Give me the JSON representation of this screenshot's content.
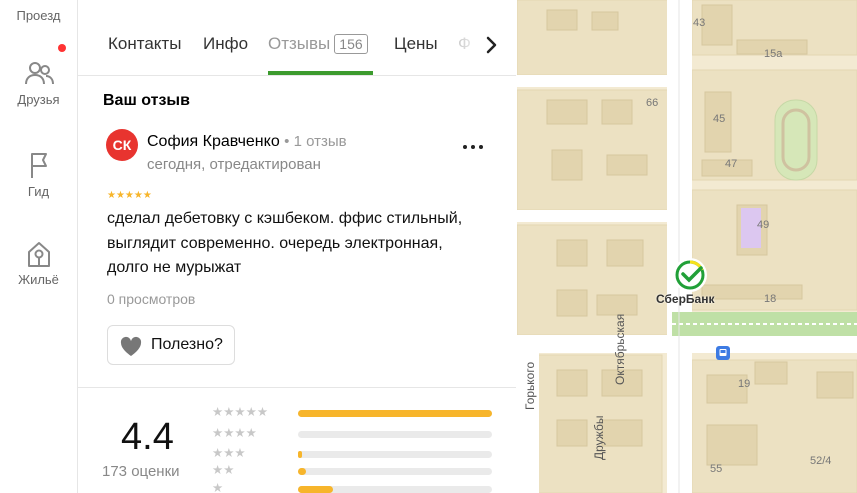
{
  "sidebar": {
    "items": [
      {
        "label": "Проезд",
        "icon": "route-icon"
      },
      {
        "label": "Друзья",
        "icon": "friends-icon",
        "has_notification": true
      },
      {
        "label": "Гид",
        "icon": "flag-icon"
      },
      {
        "label": "Жильё",
        "icon": "home-key-icon"
      }
    ]
  },
  "tabs": {
    "items": [
      {
        "label": "Контакты"
      },
      {
        "label": "Инфо"
      },
      {
        "label": "Отзывы",
        "count": "156",
        "active": true
      },
      {
        "label": "Цены"
      },
      {
        "label": "Ф"
      }
    ],
    "accent_color": "#3c9b2e"
  },
  "review": {
    "section_title": "Ваш отзыв",
    "avatar_initials": "СК",
    "avatar_color": "#e8342f",
    "author_name": "София Кравченко",
    "author_reviews": "1 отзыв",
    "date": "сегодня, отредактирован",
    "rating": 5,
    "text": "сделал дебетовку с кэшбеком. ффис стильный, выглядит современно. очередь электронная, долго не мурыжат",
    "views": "0 просмотров",
    "useful_label": "Полезно?"
  },
  "summary": {
    "rating": "4.4",
    "count_label": "173 оценки",
    "star_color": "#f7b52b",
    "distribution": [
      {
        "stars": 5,
        "fraction": 1.0
      },
      {
        "stars": 4,
        "fraction": 0.0
      },
      {
        "stars": 3,
        "fraction": 0.02
      },
      {
        "stars": 2,
        "fraction": 0.04
      },
      {
        "stars": 1,
        "fraction": 0.18
      }
    ]
  },
  "map": {
    "poi_label": "СберБанк",
    "poi_icon": "sberbank-logo-icon",
    "street_labels": [
      "Октябрьская",
      "Горького",
      "Дружбы"
    ],
    "house_numbers": [
      "43",
      "15а",
      "66",
      "45",
      "47",
      "49",
      "18",
      "19",
      "55",
      "52/4"
    ],
    "bus_stop_icon": "bus-stop-icon"
  }
}
